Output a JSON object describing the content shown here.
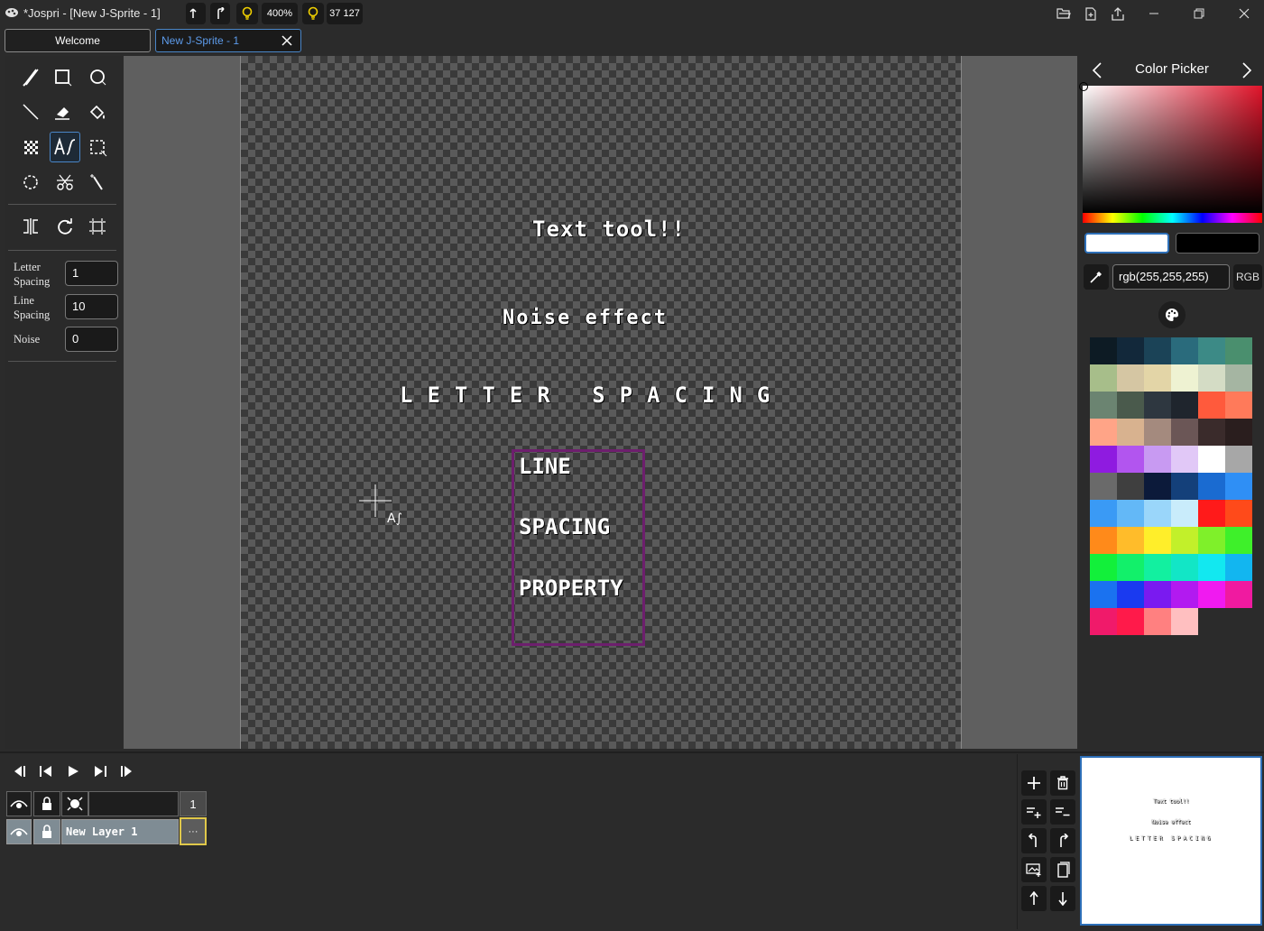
{
  "window": {
    "title": "*Jospri - [New J-Sprite - 1]",
    "zoom": "400%",
    "coords": "37 127"
  },
  "tabs": [
    {
      "label": "Welcome"
    },
    {
      "label": "New J-Sprite - 1"
    }
  ],
  "tools": [
    {
      "name": "pencil-tool"
    },
    {
      "name": "rectangle-tool"
    },
    {
      "name": "ellipse-tool"
    },
    {
      "name": "line-tool"
    },
    {
      "name": "eraser-tool"
    },
    {
      "name": "fill-tool"
    },
    {
      "name": "dither-tool"
    },
    {
      "name": "text-tool"
    },
    {
      "name": "rect-select-tool"
    },
    {
      "name": "lasso-select-tool"
    },
    {
      "name": "cut-tool"
    },
    {
      "name": "magic-wand-tool"
    },
    {
      "name": "flip-tool"
    },
    {
      "name": "rotate-tool"
    },
    {
      "name": "resize-tool"
    }
  ],
  "text_properties": {
    "letter_spacing_label_1": "Letter",
    "letter_spacing_label_2": "Spacing",
    "letter_spacing_value": "1",
    "line_spacing_label_1": "Line",
    "line_spacing_label_2": "Spacing",
    "line_spacing_value": "10",
    "noise_label": "Noise",
    "noise_value": "0"
  },
  "canvas_text": {
    "line1": "Text tool!!",
    "line2": "Noise effect",
    "line3": "LETTER SPACING",
    "box_line1": "LINE",
    "box_line2": "SPACING",
    "box_line3": "PROPERTY",
    "cursor_label": "A∫"
  },
  "color_picker": {
    "title": "Color Picker",
    "value": "rgb(255,255,255)",
    "mode": "RGB",
    "primary": "#ffffff",
    "secondary": "#000000",
    "palette": [
      "#0d1b24",
      "#12283a",
      "#1b4357",
      "#2a6b7c",
      "#3c8a86",
      "#4a8f6e",
      "#a7be8a",
      "#d5c6a3",
      "#e3d5a7",
      "#eef2d2",
      "#d4dcc5",
      "#a5b5a2",
      "#6b8471",
      "#4a5a4c",
      "#2e3740",
      "#1f252d",
      "#ff5a3c",
      "#ff7a5a",
      "#ffa487",
      "#d8b28f",
      "#a48a7e",
      "#6b5656",
      "#3a2b2b",
      "#2a1e1e",
      "#8f1be0",
      "#b255ef",
      "#c89af2",
      "#e1c8f7",
      "#ffffff",
      "#a7a7a7",
      "#6a6a6a",
      "#3f3f3f",
      "#0c1a3a",
      "#14407a",
      "#1a6bd1",
      "#2f8ff5",
      "#3a9af5",
      "#63b8f7",
      "#9ad6fa",
      "#c9ecfb",
      "#ff1a1a",
      "#ff4a1a",
      "#ff8a1a",
      "#ffbc2a",
      "#ffee2a",
      "#c2f02a",
      "#7ff02a",
      "#3ef02a",
      "#12f03a",
      "#12f06a",
      "#12f0a0",
      "#12e6c6",
      "#12e8f0",
      "#12b6f0",
      "#1a72f0",
      "#1a3af0",
      "#7a1af0",
      "#b21af0",
      "#f01af0",
      "#f01aa0",
      "#f01a6a",
      "#ff1a4a",
      "#ff8080",
      "#ffbfc0"
    ]
  },
  "timeline": {
    "frame_number": "1",
    "layer_name": "New Layer 1",
    "layer_menu": "···"
  }
}
